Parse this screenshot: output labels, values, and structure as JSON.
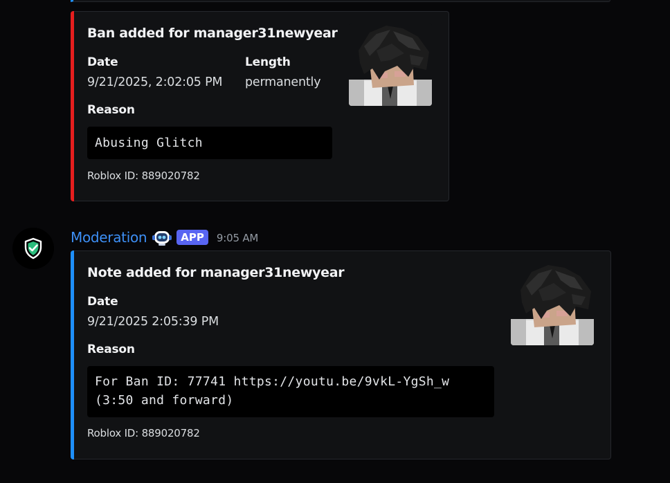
{
  "messages": [
    {
      "embed": {
        "title": "Ban added for manager31newyear",
        "accent_color": "#e51e1e",
        "fields": {
          "date": {
            "name": "Date",
            "value": "9/21/2025, 2:02:05 PM"
          },
          "length": {
            "name": "Length",
            "value": "permanently"
          },
          "reason": {
            "name": "Reason",
            "value": "Abusing Glitch"
          }
        },
        "footer": "Roblox ID: 889020782",
        "thumbnail": "roblox-avatar-headshot"
      }
    },
    {
      "author": {
        "name": "Moderation",
        "avatar_icon": "shield-check-icon",
        "bot_emoji": "robot-icon",
        "tag": "APP",
        "timestamp": "9:05 AM"
      },
      "embed": {
        "title": "Note added for manager31newyear",
        "accent_color": "#1e8ffa",
        "fields": {
          "date": {
            "name": "Date",
            "value": "9/21/2025 2:05:39 PM"
          },
          "reason": {
            "name": "Reason",
            "value": "For Ban ID: 77741 https://youtu.be/9vkL-YgSh_w (3:50 and forward)"
          }
        },
        "footer": "Roblox ID: 889020782",
        "thumbnail": "roblox-avatar-headshot"
      }
    }
  ]
}
